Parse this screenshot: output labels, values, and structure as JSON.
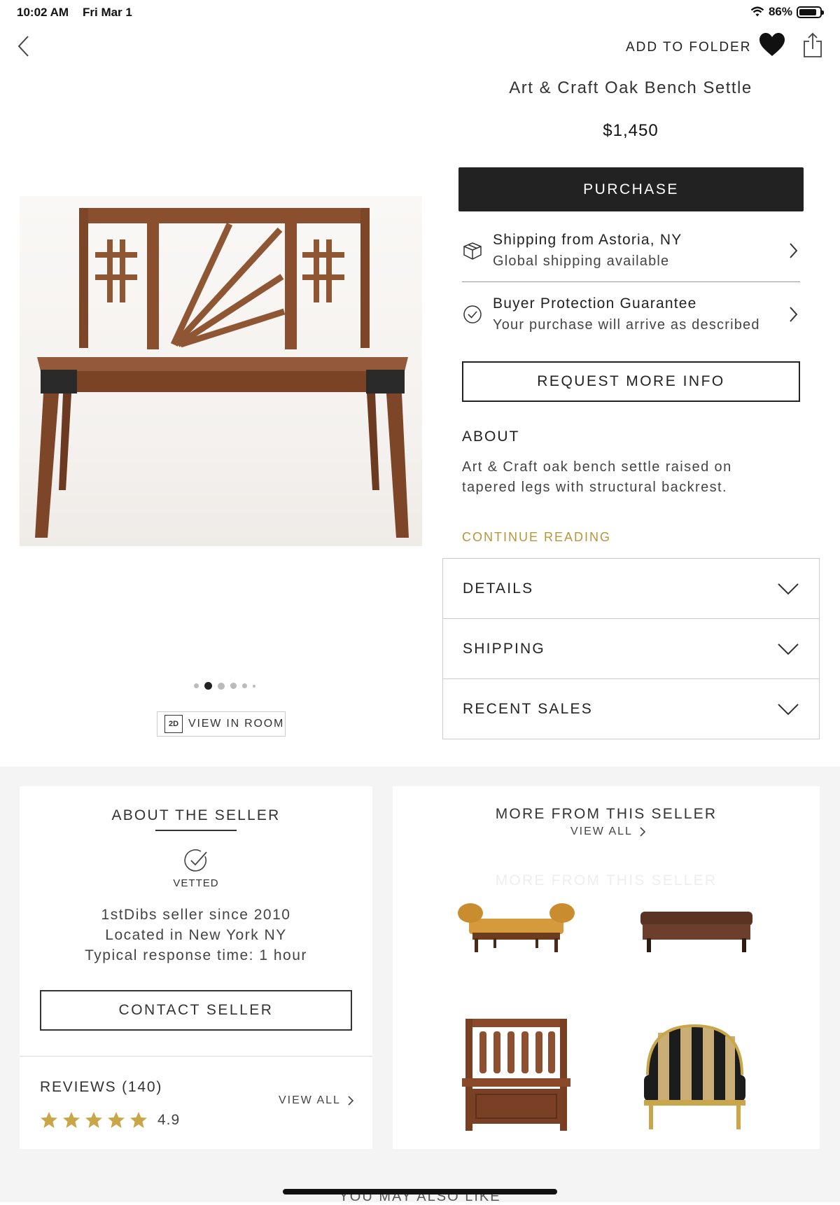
{
  "status_bar": {
    "time": "10:02 AM",
    "date": "Fri Mar 1",
    "battery": "86%"
  },
  "header": {
    "add_to_folder": "ADD TO FOLDER"
  },
  "product": {
    "title": "Art & Craft Oak Bench Settle",
    "price": "$1,450",
    "purchase_label": "PURCHASE",
    "image_dots": 6,
    "active_dot": 1,
    "view_in_room_icon": "2D",
    "view_in_room": "VIEW IN ROOM"
  },
  "shipping_row": {
    "title": "Shipping from Astoria, NY",
    "subtitle": "Global shipping available",
    "icon": "box-icon"
  },
  "protection_row": {
    "title": "Buyer Protection Guarantee",
    "subtitle": "Your purchase will arrive as described",
    "icon": "badge-check-icon"
  },
  "request_info": "REQUEST MORE INFO",
  "about": {
    "heading": "ABOUT",
    "text": "Art & Craft oak bench settle raised on tapered legs with structural backrest.",
    "continue": "CONTINUE READING"
  },
  "accordions": [
    {
      "label": "DETAILS"
    },
    {
      "label": "SHIPPING"
    },
    {
      "label": "RECENT SALES"
    }
  ],
  "seller": {
    "heading": "ABOUT THE SELLER",
    "badge": "VETTED",
    "line1": "1stDibs seller since 2010",
    "line2": "Located in New York NY",
    "line3": "Typical response time: 1 hour",
    "contact": "CONTACT SELLER",
    "reviews_label": "REVIEWS (140)",
    "view_all": "VIEW ALL",
    "rating": "4.9",
    "stars": 5
  },
  "more_from_seller": {
    "heading": "MORE FROM THIS SELLER",
    "view_all": "VIEW ALL",
    "items": [
      "tan leather bench",
      "brown leather ottoman",
      "carved oak settle",
      "striped settee"
    ]
  },
  "footer": {
    "you_may_also_like": "YOU MAY ALSO LIKE"
  },
  "colors": {
    "accent_gold": "#b8953a",
    "dark_button": "#222222",
    "star": "#c9a64a"
  }
}
